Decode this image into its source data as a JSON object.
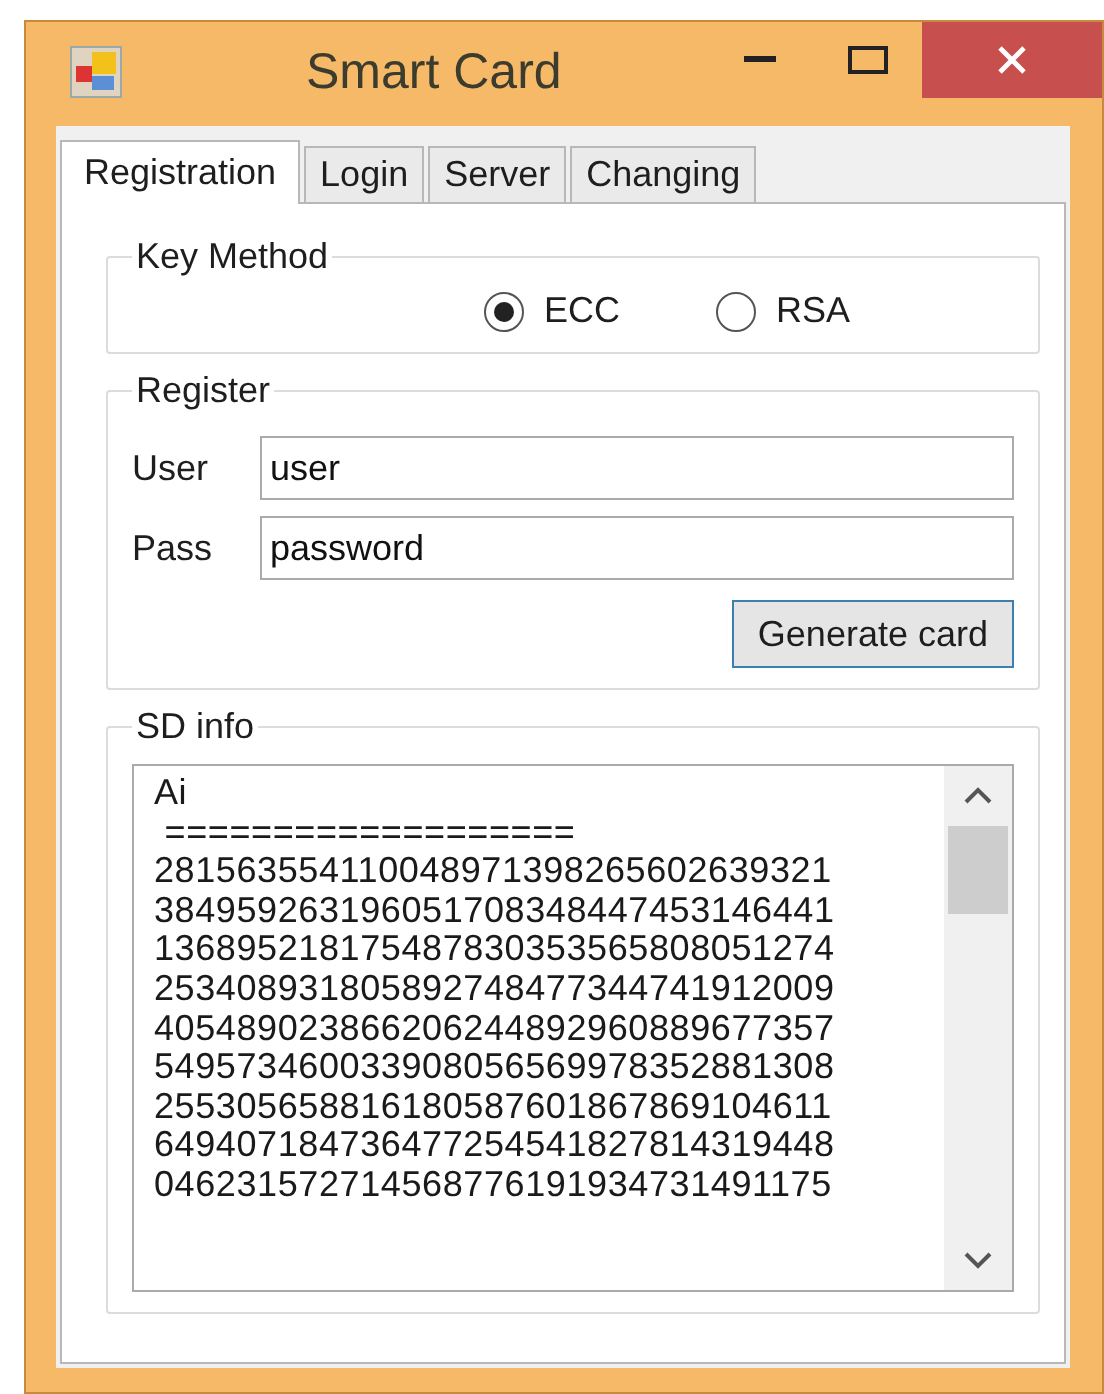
{
  "window": {
    "title": "Smart Card"
  },
  "tabs": [
    {
      "label": "Registration",
      "selected": true
    },
    {
      "label": "Login",
      "selected": false
    },
    {
      "label": "Server",
      "selected": false
    },
    {
      "label": "Changing",
      "selected": false
    }
  ],
  "key_method": {
    "title": "Key Method",
    "options": [
      {
        "label": "ECC",
        "selected": true
      },
      {
        "label": "RSA",
        "selected": false
      }
    ]
  },
  "register": {
    "title": "Register",
    "fields": [
      {
        "label": "User",
        "value": "user"
      },
      {
        "label": "Pass",
        "value": "password"
      }
    ],
    "button": "Generate card"
  },
  "sd_info": {
    "title": "SD info",
    "lines": [
      "Ai",
      " ===================",
      "281563554110048971398265602639321",
      "384959263196051708348447453146441",
      "136895218175487830353565808051274",
      "253408931805892748477344741912009",
      "405489023866206244892960889677357",
      "549573460033908056569978352881308",
      "255305658816180587601867869104611",
      "649407184736477254541827814319448",
      "046231572714568776191934731491175"
    ]
  }
}
